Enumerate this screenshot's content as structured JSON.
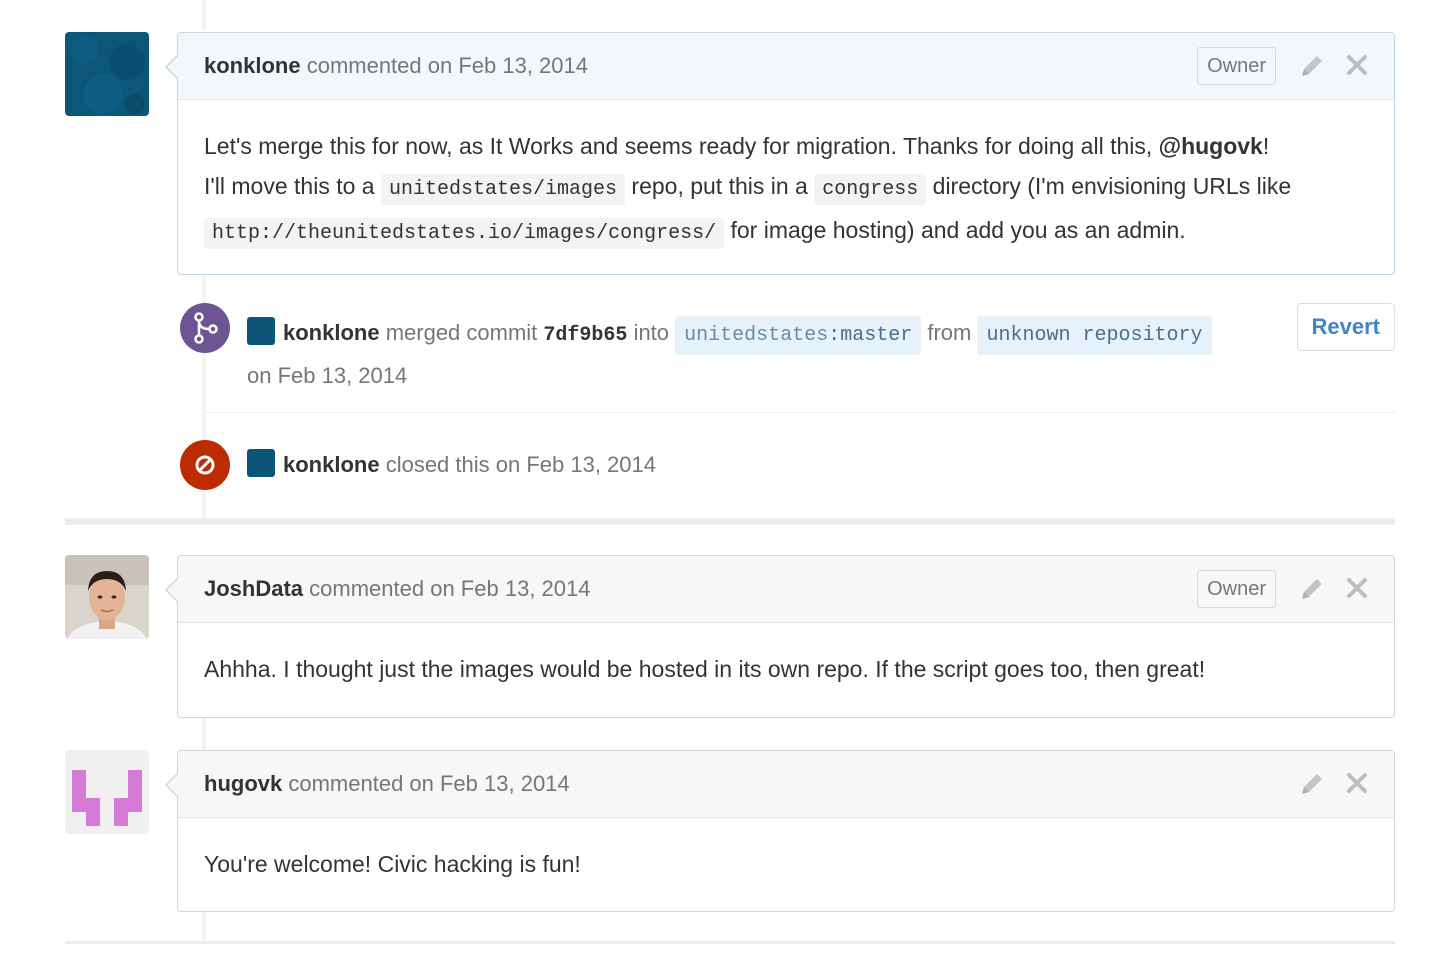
{
  "comments": [
    {
      "author": "konklone",
      "meta": "commented on Feb 13, 2014",
      "badge": "Owner",
      "avatar_icon": "konklone-avatar",
      "body": {
        "p1_a": "Let's merge this for now, as It Works and seems ready for migration. Thanks for doing all this, ",
        "mention": "@hugovk",
        "p1_b": "!",
        "p2_a": "I'll move this to a ",
        "code1": "unitedstates/images",
        "p2_b": " repo, put this in a ",
        "code2": "congress",
        "p2_c": " directory (I'm envisioning URLs like ",
        "code3": "http://theunitedstates.io/images/congress/",
        "p2_d": " for image hosting) and add you as an admin."
      }
    },
    {
      "author": "JoshData",
      "meta": "commented on Feb 13, 2014",
      "badge": "Owner",
      "avatar_icon": "joshdata-avatar",
      "body": "Ahhha. I thought just the images would be hosted in its own repo. If the script goes too, then great!"
    },
    {
      "author": "hugovk",
      "meta": "commented on Feb 13, 2014",
      "avatar_icon": "hugovk-identicon",
      "body": "You're welcome! Civic hacking is fun!"
    }
  ],
  "merge_event": {
    "actor": "konklone",
    "text_merged": "merged commit",
    "sha": "7df9b65",
    "text_into": "into",
    "target_owner": "unitedstates",
    "target_branch": "master",
    "text_from": "from",
    "source": "unknown repository",
    "date": "on Feb 13, 2014",
    "revert_label": "Revert",
    "icon": "git-merge-icon",
    "icon_color": "#6e5494"
  },
  "close_event": {
    "actor": "konklone",
    "text": "closed this on Feb 13, 2014",
    "icon": "closed-pr-icon",
    "icon_color": "#bd2c00"
  },
  "colors": {
    "link": "#4183c4",
    "owner_badge_border": "#d8d8d8"
  }
}
